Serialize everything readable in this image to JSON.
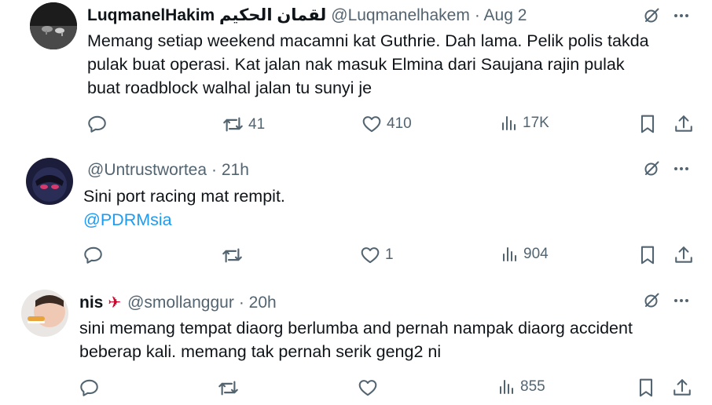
{
  "tweets": [
    {
      "name": "LuqmanelHakim لقمان الحكيم",
      "handle": "@Luqmanelhakem",
      "time": "· Aug 2",
      "body_lines": [
        "Memang setiap weekend macamni kat Guthrie. Dah lama. Pelik polis takda",
        "pulak buat operasi. Kat jalan nak masuk Elmina  dari Saujana rajin pulak",
        "buat roadblock walhal jalan tu sunyi je"
      ],
      "retweets": "41",
      "likes": "410",
      "views": "17K"
    },
    {
      "name": "",
      "handle": "@Untrustwortea",
      "time": "· 21h",
      "body_lines": [
        "Sini port racing mat rempit."
      ],
      "mention": "@PDRMsia",
      "retweets": "",
      "likes": "1",
      "views": "904"
    },
    {
      "name": "nis",
      "handle": "@smollanggur",
      "time": "· 20h",
      "body_lines": [
        "sini memang tempat diaorg berlumba and pernah nampak diaorg accident",
        "beberap kali. memang tak pernah serik geng2 ni"
      ],
      "retweets": "",
      "likes": "",
      "views": "855"
    }
  ],
  "icons": {
    "reply": "reply-icon",
    "retweet": "retweet-icon",
    "like": "heart-icon",
    "views": "views-icon",
    "bookmark": "bookmark-icon",
    "share": "share-icon",
    "grok": "grok-icon",
    "more": "more-icon"
  },
  "colors": {
    "text": "#0f1419",
    "secondary": "#536471",
    "link": "#1d9bf0"
  }
}
